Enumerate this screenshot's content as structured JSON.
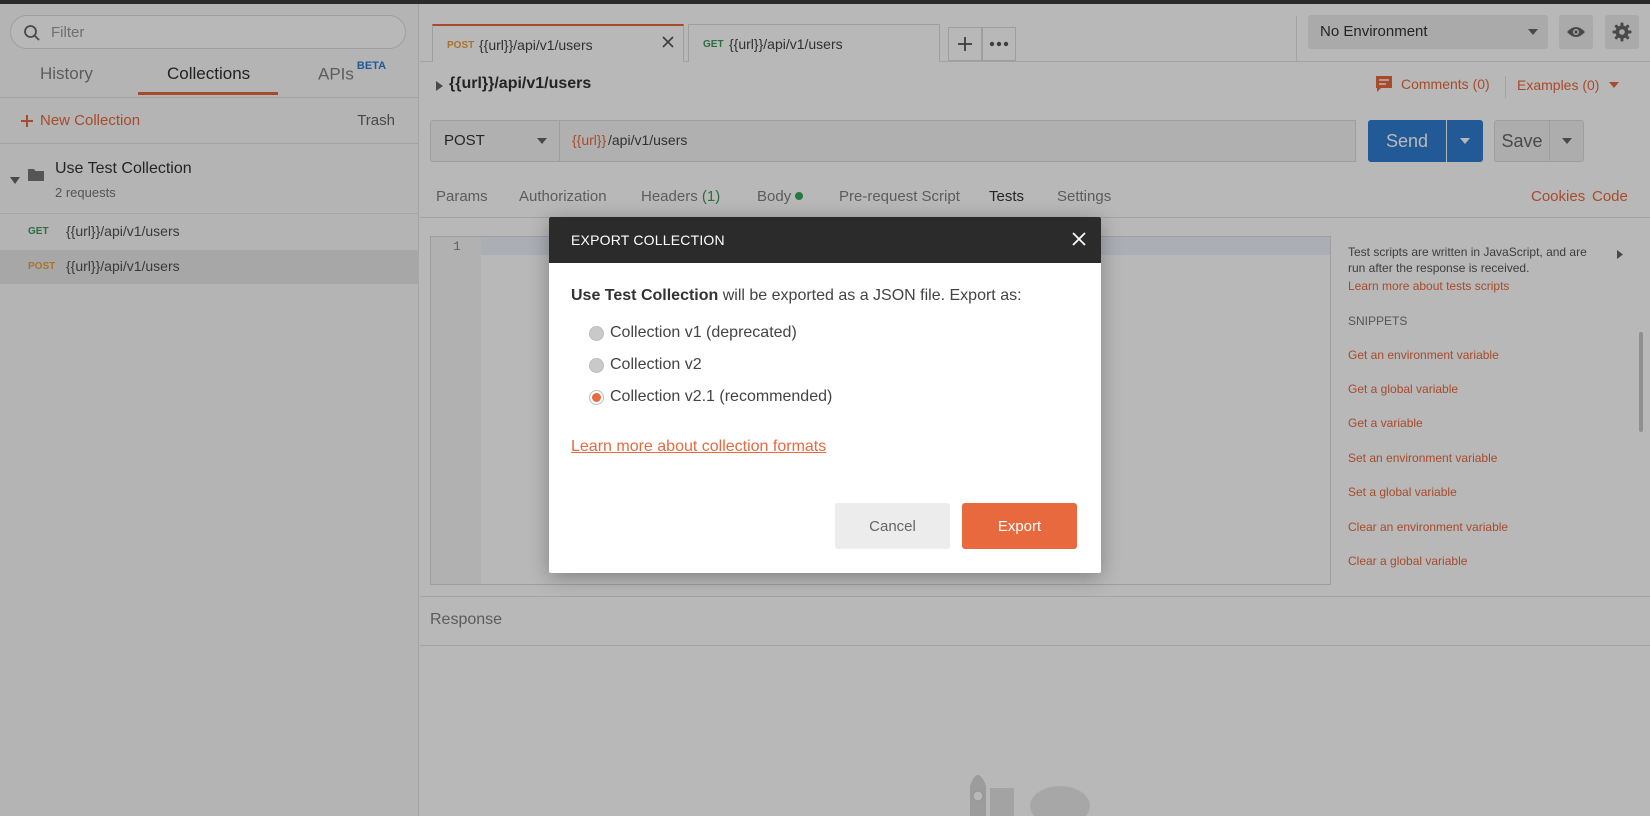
{
  "sidebar": {
    "filter_placeholder": "Filter",
    "tabs": [
      {
        "label": "History"
      },
      {
        "label": "Collections"
      },
      {
        "label": "APIs",
        "badge": "BETA"
      }
    ],
    "new_collection_label": "New Collection",
    "trash_label": "Trash",
    "collection": {
      "name": "Use Test Collection",
      "count": "2 requests"
    },
    "requests": [
      {
        "method": "GET",
        "url": "{{url}}/api/v1/users",
        "method_color": "#3a9a5a"
      },
      {
        "method": "POST",
        "url": "{{url}}/api/v1/users",
        "method_color": "#e8a23a"
      }
    ]
  },
  "tabs": [
    {
      "method": "POST",
      "url": "{{url}}/api/v1/users"
    },
    {
      "method": "GET",
      "url": "{{url}}/api/v1/users"
    }
  ],
  "environment": {
    "selected": "No Environment"
  },
  "request": {
    "title": "{{url}}/api/v1/users",
    "comments_label": "Comments (0)",
    "examples_label": "Examples (0)",
    "method": "POST",
    "url_var": "{{url}}",
    "url_path": "/api/v1/users",
    "send_label": "Send",
    "save_label": "Save"
  },
  "subtabs": {
    "params": "Params",
    "authorization": "Authorization",
    "headers": "Headers",
    "headers_count": "(1)",
    "body": "Body",
    "prerequest": "Pre-request Script",
    "tests": "Tests",
    "settings": "Settings",
    "cookies": "Cookies",
    "code": "Code"
  },
  "editor": {
    "line_number": "1"
  },
  "snippets": {
    "description": "Test scripts are written in JavaScript, and are run after the response is received.",
    "learn_more": "Learn more about tests scripts",
    "heading": "SNIPPETS",
    "items": [
      "Get an environment variable",
      "Get a global variable",
      "Get a variable",
      "Set an environment variable",
      "Set a global variable",
      "Clear an environment variable",
      "Clear a global variable"
    ]
  },
  "response": {
    "label": "Response"
  },
  "modal": {
    "title": "EXPORT COLLECTION",
    "collection_name": "Use Test Collection",
    "message_suffix": " will be exported as a JSON file. Export as:",
    "options": [
      {
        "label": "Collection v1 (deprecated)",
        "checked": false
      },
      {
        "label": "Collection v2",
        "checked": false
      },
      {
        "label": "Collection v2.1 (recommended)",
        "checked": true
      }
    ],
    "link_label": "Learn more about collection formats",
    "cancel_label": "Cancel",
    "export_label": "Export"
  },
  "colors": {
    "accent": "#e8693e",
    "primary": "#2e7dd1",
    "get": "#3a9a5a",
    "post": "#e8a23a"
  }
}
